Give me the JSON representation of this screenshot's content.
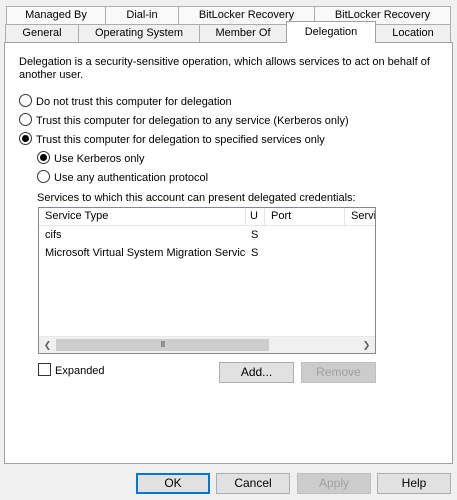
{
  "tabs_back": [
    {
      "label": "Managed By"
    },
    {
      "label": "Dial-in"
    },
    {
      "label": "BitLocker Recovery"
    },
    {
      "label": "BitLocker Recovery"
    }
  ],
  "tabs_front": [
    {
      "label": "General"
    },
    {
      "label": "Operating System"
    },
    {
      "label": "Member Of"
    },
    {
      "label": "Delegation"
    },
    {
      "label": "Location"
    }
  ],
  "active_tab": "Delegation",
  "delegation": {
    "description": "Delegation is a security-sensitive operation, which allows services to act on behalf of another user.",
    "options": [
      {
        "label": "Do not trust this computer for delegation",
        "selected": false
      },
      {
        "label": "Trust this computer for delegation to any service (Kerberos only)",
        "selected": false
      },
      {
        "label": "Trust this computer for delegation to specified services only",
        "selected": true
      }
    ],
    "sub_options": [
      {
        "label": "Use Kerberos only",
        "selected": true
      },
      {
        "label": "Use any authentication protocol",
        "selected": false
      }
    ],
    "services_label": "Services to which this account can present delegated credentials:",
    "columns": [
      "Service Type",
      "U",
      "Port",
      "Servi"
    ],
    "rows": [
      {
        "service_type": "cifs",
        "u": "S",
        "port": "",
        "service": ""
      },
      {
        "service_type": "Microsoft Virtual System Migration Service",
        "u": "S",
        "port": "",
        "service": ""
      }
    ],
    "scroll_glyph": "III",
    "expanded_label": "Expanded",
    "expanded_checked": false,
    "add_button": "Add...",
    "remove_button": "Remove"
  },
  "dialog_buttons": {
    "ok": "OK",
    "cancel": "Cancel",
    "apply": "Apply",
    "help": "Help"
  }
}
